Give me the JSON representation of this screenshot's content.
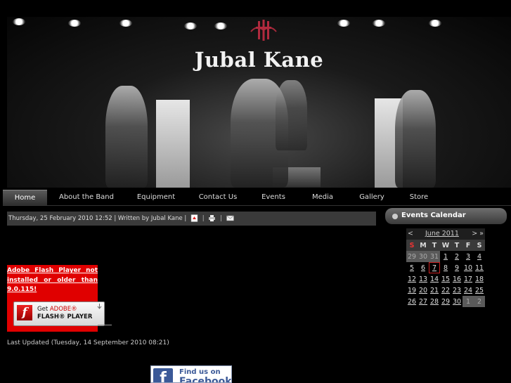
{
  "header": {
    "band_name": "Jubal Kane"
  },
  "nav": {
    "items": [
      {
        "label": "Home"
      },
      {
        "label": "About the Band"
      },
      {
        "label": "Equipment"
      },
      {
        "label": "Contact Us"
      },
      {
        "label": "Events"
      },
      {
        "label": "Media"
      },
      {
        "label": "Gallery"
      },
      {
        "label": "Store"
      }
    ],
    "active": "Home"
  },
  "article": {
    "meta": "Thursday, 25 February 2010 12:52 | Written by Jubal Kane |",
    "flash_notice": "Adobe Flash Player not installed or older than 9.0.115!",
    "flash_button": {
      "line1": "Get",
      "line1_brand": "ADOBE®",
      "line2": "FLASH® PLAYER",
      "icon": "f"
    },
    "last_updated": "Last Updated (Tuesday, 14 September 2010 08:21)"
  },
  "facebook": {
    "line1": "Find us on",
    "line2": "Facebook",
    "icon": "f"
  },
  "sidebar": {
    "calendar": {
      "title": "Events Calendar",
      "prev": "<",
      "month": "June 2011",
      "next": "> »",
      "weekdays": [
        "S",
        "M",
        "T",
        "W",
        "T",
        "F",
        "S"
      ],
      "weeks": [
        [
          {
            "d": "29",
            "o": true
          },
          {
            "d": "30",
            "o": true
          },
          {
            "d": "31",
            "o": true
          },
          {
            "d": "1"
          },
          {
            "d": "2"
          },
          {
            "d": "3"
          },
          {
            "d": "4"
          }
        ],
        [
          {
            "d": "5"
          },
          {
            "d": "6"
          },
          {
            "d": "7",
            "today": true
          },
          {
            "d": "8"
          },
          {
            "d": "9"
          },
          {
            "d": "10"
          },
          {
            "d": "11"
          }
        ],
        [
          {
            "d": "12"
          },
          {
            "d": "13"
          },
          {
            "d": "14"
          },
          {
            "d": "15"
          },
          {
            "d": "16"
          },
          {
            "d": "17"
          },
          {
            "d": "18"
          }
        ],
        [
          {
            "d": "19"
          },
          {
            "d": "20"
          },
          {
            "d": "21"
          },
          {
            "d": "22"
          },
          {
            "d": "23"
          },
          {
            "d": "24"
          },
          {
            "d": "25"
          }
        ],
        [
          {
            "d": "26"
          },
          {
            "d": "27"
          },
          {
            "d": "28"
          },
          {
            "d": "29"
          },
          {
            "d": "30"
          },
          {
            "d": "1",
            "o": true
          },
          {
            "d": "2",
            "o": true
          }
        ]
      ]
    }
  },
  "colors": {
    "flash_red": "#e00000",
    "facebook_blue": "#3b5998",
    "calendar_today": "#cc2222",
    "sunday": "#ee3333"
  }
}
